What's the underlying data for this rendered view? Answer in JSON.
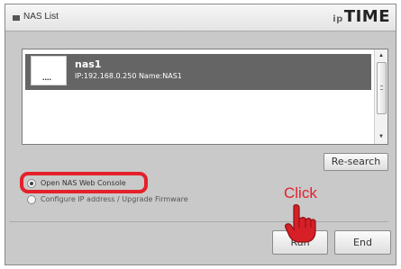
{
  "window": {
    "title": "NAS List",
    "brand_prefix": "ip",
    "brand": "TIME"
  },
  "nas_list": {
    "items": [
      {
        "icon_text": "....",
        "name": "nas1",
        "info": "IP:192.168.0.250  Name:NAS1",
        "selected": true
      }
    ]
  },
  "buttons": {
    "research": "Re-search",
    "run": "Run",
    "end": "End"
  },
  "options": [
    {
      "label": "Open NAS Web Console",
      "checked": true
    },
    {
      "label": "Configure IP address / Upgrade Firmware",
      "checked": false
    }
  ],
  "annotation": {
    "click_label": "Click",
    "highlight_color": "#e4202a"
  },
  "icons": {
    "title_icon": "window-square-icon",
    "device_icon": "nas-device-icon",
    "hand_icon": "pointing-hand-icon"
  }
}
